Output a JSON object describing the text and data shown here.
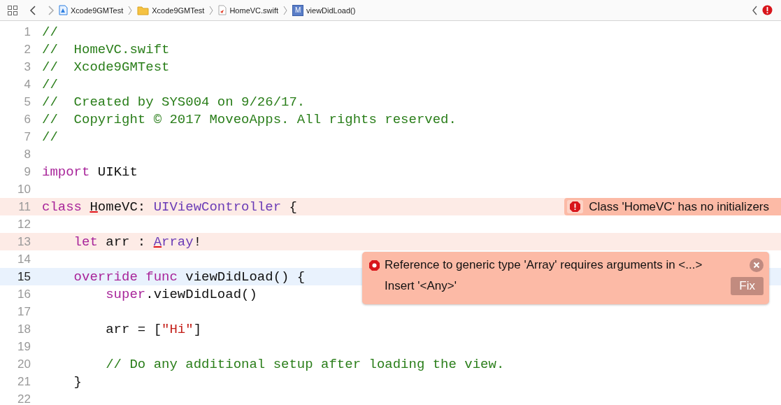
{
  "jump_bar": {
    "crumbs": [
      {
        "kind": "project",
        "label": "Xcode9GMTest"
      },
      {
        "kind": "folder",
        "label": "Xcode9GMTest"
      },
      {
        "kind": "swift",
        "label": "HomeVC.swift"
      },
      {
        "kind": "method",
        "label": "viewDidLoad()",
        "badge": "M"
      }
    ]
  },
  "editor": {
    "lines": [
      {
        "number": "1",
        "error": false,
        "current": false,
        "tokens": [
          {
            "text": "//",
            "kind": "comment"
          }
        ]
      },
      {
        "number": "2",
        "error": false,
        "current": false,
        "tokens": [
          {
            "text": "//  HomeVC.swift",
            "kind": "comment"
          }
        ]
      },
      {
        "number": "3",
        "error": false,
        "current": false,
        "tokens": [
          {
            "text": "//  Xcode9GMTest",
            "kind": "comment"
          }
        ]
      },
      {
        "number": "4",
        "error": false,
        "current": false,
        "tokens": [
          {
            "text": "//",
            "kind": "comment"
          }
        ]
      },
      {
        "number": "5",
        "error": false,
        "current": false,
        "tokens": [
          {
            "text": "//  Created by SYS004 on 9/26/17.",
            "kind": "comment"
          }
        ]
      },
      {
        "number": "6",
        "error": false,
        "current": false,
        "tokens": [
          {
            "text": "//  Copyright © 2017 MoveoApps. All rights reserved.",
            "kind": "comment"
          }
        ]
      },
      {
        "number": "7",
        "error": false,
        "current": false,
        "tokens": [
          {
            "text": "//",
            "kind": "comment"
          }
        ]
      },
      {
        "number": "8",
        "error": false,
        "current": false
      },
      {
        "number": "9",
        "error": false,
        "current": false,
        "tokens": [
          {
            "text": "import",
            "kind": "keyword"
          },
          {
            "text": " UIKit",
            "kind": "plain"
          }
        ]
      },
      {
        "number": "10",
        "error": false,
        "current": false
      },
      {
        "number": "11",
        "error": true,
        "current": false,
        "message": "Class 'HomeVC' has no initializers",
        "tokens": [
          {
            "text": "class ",
            "kind": "keyword"
          },
          {
            "text": "H",
            "kind": "plain",
            "underline": true
          },
          {
            "text": "omeVC: ",
            "kind": "plain"
          },
          {
            "text": "UIViewController",
            "kind": "type"
          },
          {
            "text": " {",
            "kind": "plain"
          }
        ]
      },
      {
        "number": "12",
        "error": false,
        "current": false
      },
      {
        "number": "13",
        "error": true,
        "current": false,
        "tokens": [
          {
            "text": "    let",
            "kind": "keyword"
          },
          {
            "text": " arr : ",
            "kind": "plain"
          },
          {
            "text": "A",
            "kind": "type",
            "underline": true
          },
          {
            "text": "rray",
            "kind": "type"
          },
          {
            "text": "!",
            "kind": "plain"
          }
        ]
      },
      {
        "number": "14",
        "error": false,
        "current": false
      },
      {
        "number": "15",
        "error": false,
        "current": true,
        "tokens": [
          {
            "text": "    override func",
            "kind": "keyword"
          },
          {
            "text": " viewDidLoad() {",
            "kind": "plain"
          }
        ]
      },
      {
        "number": "16",
        "error": false,
        "current": false,
        "tokens": [
          {
            "text": "        super",
            "kind": "keyword"
          },
          {
            "text": ".viewDidLoad()",
            "kind": "plain"
          }
        ]
      },
      {
        "number": "17",
        "error": false,
        "current": false
      },
      {
        "number": "18",
        "error": false,
        "current": false,
        "tokens": [
          {
            "text": "        arr = [",
            "kind": "plain"
          },
          {
            "text": "\"Hi\"",
            "kind": "string"
          },
          {
            "text": "]",
            "kind": "plain"
          }
        ]
      },
      {
        "number": "19",
        "error": false,
        "current": false
      },
      {
        "number": "20",
        "error": false,
        "current": false,
        "tokens": [
          {
            "text": "        // Do any additional setup after loading the view.",
            "kind": "comment"
          }
        ]
      },
      {
        "number": "21",
        "error": false,
        "current": false,
        "tokens": [
          {
            "text": "    }",
            "kind": "plain"
          }
        ]
      },
      {
        "number": "22",
        "error": false,
        "current": false
      }
    ]
  },
  "fixit": {
    "message": "Reference to generic type 'Array' requires arguments in <...>",
    "suggestion": "Insert '<Any>'",
    "button": "Fix"
  }
}
